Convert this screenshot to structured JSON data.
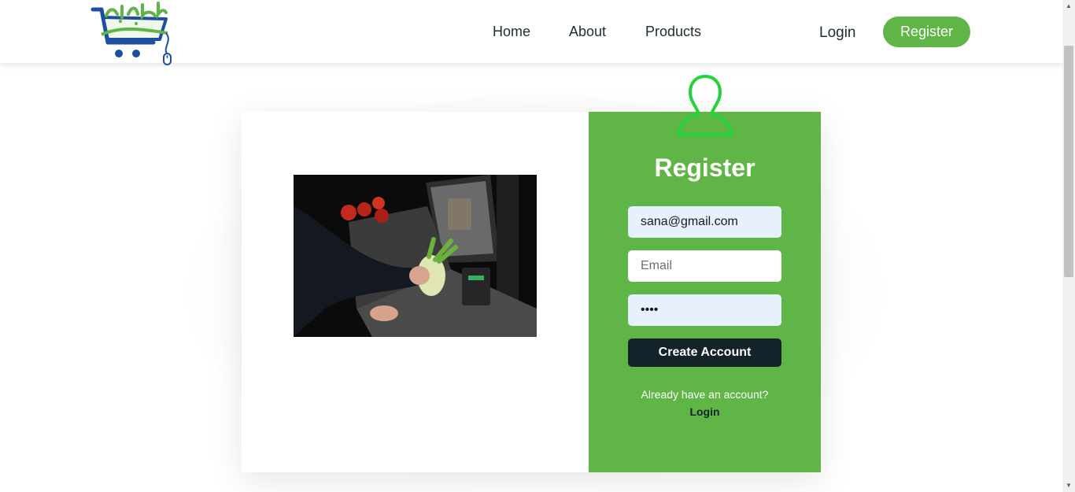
{
  "nav": {
    "links": [
      "Home",
      "About",
      "Products"
    ],
    "login_label": "Login",
    "register_label": "Register"
  },
  "form": {
    "title": "Register",
    "username_value": "sana@gmail.com",
    "email_placeholder": "Email",
    "password_value": "••••",
    "submit_label": "Create Account",
    "already_text": "Already have an account?",
    "login_link_label": "Login"
  },
  "colors": {
    "brand_green": "#5fb545",
    "dark_button": "#13232a",
    "autofill_bg": "#e8f0fe",
    "icon_outline": "#22d33a"
  },
  "icons": {
    "logo": "cart-logo-icon",
    "user": "user-outline-icon"
  }
}
